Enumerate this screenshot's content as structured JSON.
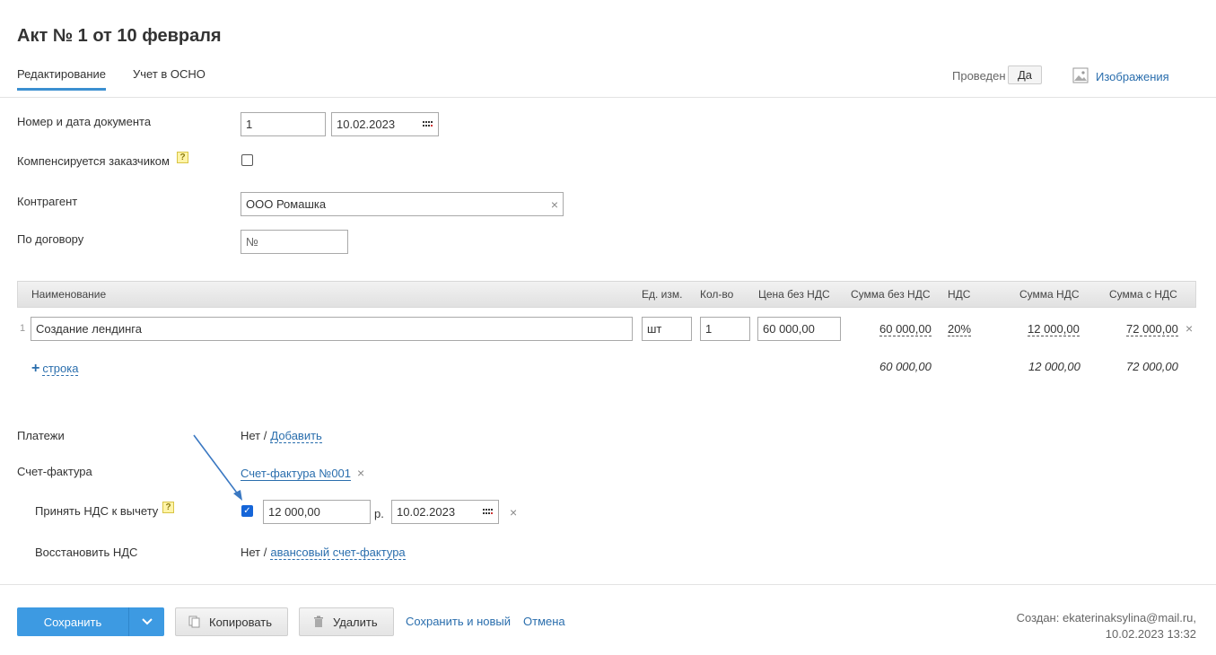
{
  "header": {
    "title": "Акт № 1 от 10 февраля",
    "tabs": [
      "Редактирование",
      "Учет в ОСНО"
    ],
    "posted_label": "Проведен",
    "posted_value": "Да",
    "images_label": "Изображения"
  },
  "form": {
    "doc_label": "Номер и дата документа",
    "doc_number": "1",
    "doc_date": "10.02.2023",
    "compensated_label": "Компенсируется заказчиком",
    "help_mark": "?",
    "contractor_label": "Контрагент",
    "contractor_value": "ООО Ромашка",
    "contract_label": "По договору",
    "contract_placeholder": "№"
  },
  "table": {
    "headers": [
      "Наименование",
      "Ед. изм.",
      "Кол-во",
      "Цена без НДС",
      "Сумма без НДС",
      "НДС",
      "Сумма НДС",
      "Сумма с НДС"
    ],
    "rows": [
      {
        "index": "1",
        "name": "Создание лендинга",
        "unit": "шт",
        "qty": "1",
        "price": "60 000,00",
        "sum": "60 000,00",
        "vat": "20%",
        "vat_sum": "12 000,00",
        "total": "72 000,00"
      }
    ],
    "add_row": "строка",
    "add_plus": "+",
    "totals": {
      "sum": "60 000,00",
      "vat_sum": "12 000,00",
      "total": "72 000,00"
    }
  },
  "payments": {
    "label": "Платежи",
    "none": "Нет /",
    "add": "Добавить"
  },
  "invoice": {
    "label": "Счет-фактура",
    "link": "Счет-фактура №001",
    "accept_label": "Принять НДС к вычету",
    "accept_amount": "12 000,00",
    "currency": "р.",
    "accept_date": "10.02.2023",
    "restore_label": "Восстановить НДС",
    "restore_none": "Нет /",
    "restore_link": "авансовый счет-фактура"
  },
  "footer": {
    "save": "Сохранить",
    "copy": "Копировать",
    "delete": "Удалить",
    "save_new": "Сохранить и новый",
    "cancel": "Отмена",
    "created_line1": "Создан: ekaterinaksylina@mail.ru,",
    "created_line2": "10.02.2023 13:32"
  },
  "colors": {
    "accent": "#3d9ae2",
    "link": "#2a6ead",
    "arrow": "#3a78c2"
  },
  "icons": {
    "clear": "×",
    "calendar": "calendar-icon",
    "image": "image-icon",
    "copy": "copy-icon",
    "trash": "trash-icon",
    "chevron": "chevron-down-icon"
  }
}
